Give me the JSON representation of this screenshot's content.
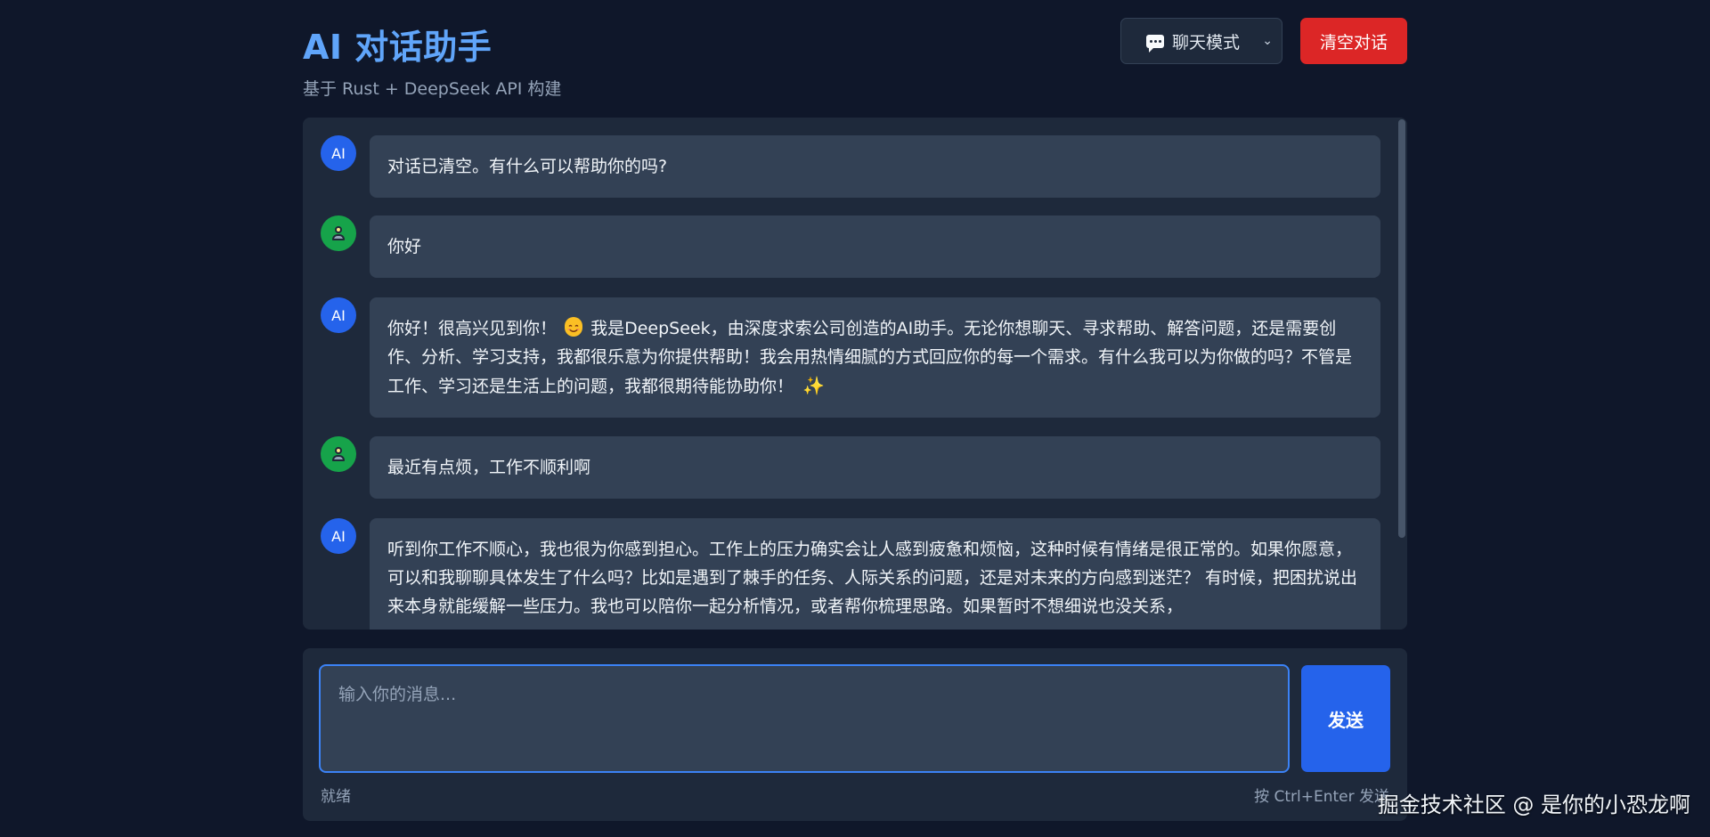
{
  "header": {
    "title": "AI 对话助手",
    "subtitle": "基于 Rust + DeepSeek API 构建",
    "mode_select": {
      "icon": "chat-bubble-icon",
      "value": "聊天模式"
    },
    "clear_label": "清空对话"
  },
  "messages": [
    {
      "role": "ai",
      "avatar_label": "AI",
      "text": "对话已清空。有什么可以帮助你的吗?"
    },
    {
      "role": "user",
      "avatar_icon": "user-icon",
      "text": "你好"
    },
    {
      "role": "ai",
      "avatar_label": "AI",
      "text_before_emoji": "你好！很高兴见到你！",
      "text_after_emoji": "我是DeepSeek，由深度求索公司创造的AI助手。无论你想聊天、寻求帮助、解答问题，还是需要创作、分析、学习支持，我都很乐意为你提供帮助！我会用热情细腻的方式回应你的每一个需求。有什么我可以为你做的吗？不管是工作、学习还是生活上的问题，我都很期待能协助你！",
      "emoji_smile": "smiling-face-icon",
      "emoji_end": "sparkles-icon"
    },
    {
      "role": "user",
      "avatar_icon": "user-icon",
      "text": "最近有点烦，工作不顺利啊"
    },
    {
      "role": "ai",
      "avatar_label": "AI",
      "text": "听到你工作不顺心，我也很为你感到担心。工作上的压力确实会让人感到疲惫和烦恼，这种时候有情绪是很正常的。如果你愿意，可以和我聊聊具体发生了什么吗？比如是遇到了棘手的任务、人际关系的问题，还是对未来的方向感到迷茫？ 有时候，把困扰说出来本身就能缓解一些压力。我也可以陪你一起分析情况，或者帮你梳理思路。如果暂时不想细说也没关系，"
    }
  ],
  "composer": {
    "placeholder": "输入你的消息...",
    "send_label": "发送",
    "status": "就绪",
    "hint": "按 Ctrl+Enter 发送"
  },
  "watermark": "掘金技术社区 @ 是你的小恐龙啊",
  "colors": {
    "background": "#0f172a",
    "panel": "#1e293b",
    "bubble": "#334155",
    "accent": "#2563eb",
    "title": "#60a5fa",
    "danger": "#dc2626",
    "user_avatar": "#16a34a"
  }
}
